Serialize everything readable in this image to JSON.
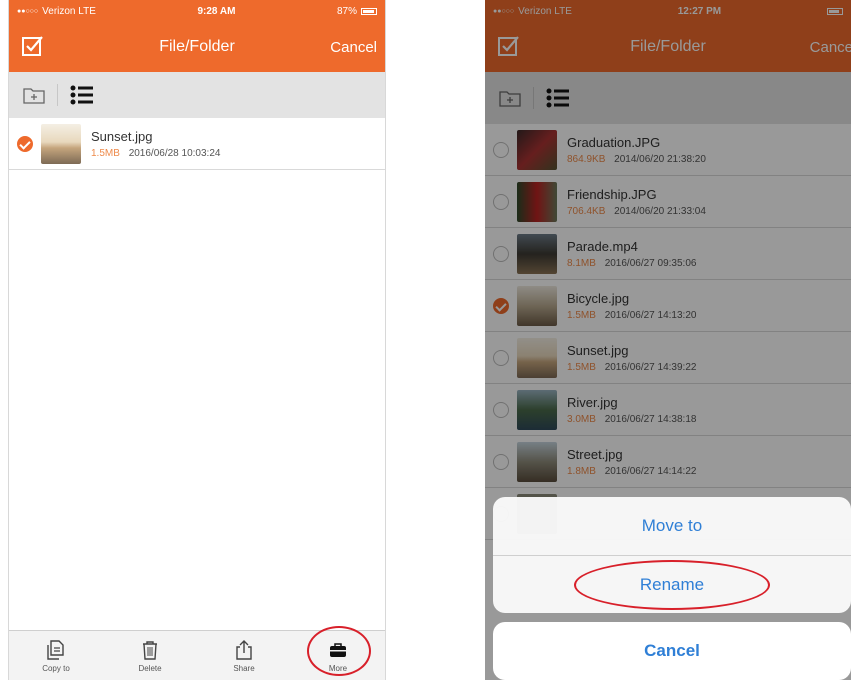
{
  "left": {
    "status": {
      "carrier": "Verizon  LTE",
      "time": "9:28 AM",
      "battery": "87%"
    },
    "nav": {
      "title": "File/Folder",
      "cancel": "Cancel"
    },
    "files": [
      {
        "name": "Sunset.jpg",
        "size": "1.5MB",
        "date": "2016/06/28 10:03:24",
        "selected": true
      }
    ],
    "bottom": {
      "copy_to": "Copy to",
      "delete": "Delete",
      "share": "Share",
      "more": "More"
    }
  },
  "right": {
    "status": {
      "carrier": "Verizon  LTE",
      "time": "12:27 PM"
    },
    "nav": {
      "title": "File/Folder",
      "cancel": "Cance"
    },
    "files": [
      {
        "name": "Graduation.JPG",
        "size": "864.9KB",
        "date": "2014/06/20 21:38:20",
        "selected": false
      },
      {
        "name": "Friendship.JPG",
        "size": "706.4KB",
        "date": "2014/06/20 21:33:04",
        "selected": false
      },
      {
        "name": "Parade.mp4",
        "size": "8.1MB",
        "date": "2016/06/27 09:35:06",
        "selected": false
      },
      {
        "name": "Bicycle.jpg",
        "size": "1.5MB",
        "date": "2016/06/27 14:13:20",
        "selected": true
      },
      {
        "name": "Sunset.jpg",
        "size": "1.5MB",
        "date": "2016/06/27 14:39:22",
        "selected": false
      },
      {
        "name": "River.jpg",
        "size": "3.0MB",
        "date": "2016/06/27 14:38:18",
        "selected": false
      },
      {
        "name": "Street.jpg",
        "size": "1.8MB",
        "date": "2016/06/27 14:14:22",
        "selected": false
      }
    ],
    "action_sheet": {
      "move_to": "Move to",
      "rename": "Rename",
      "cancel": "Cancel"
    }
  },
  "colors": {
    "accent": "#ee6a2c",
    "action_blue": "#2f7fd6",
    "highlight_ring": "#d8202a"
  }
}
